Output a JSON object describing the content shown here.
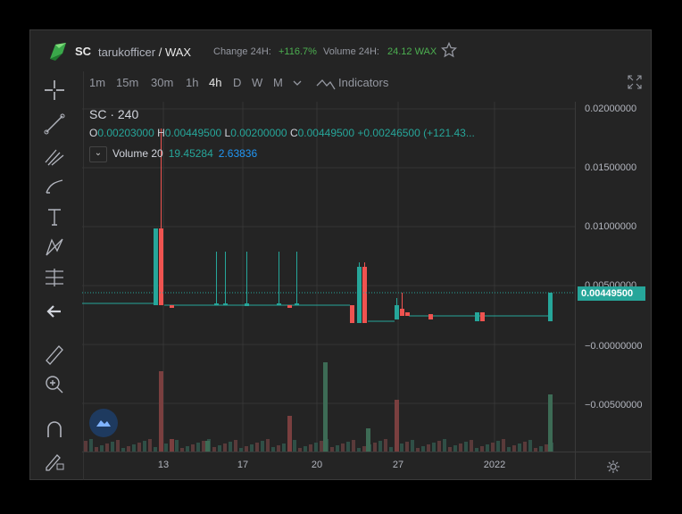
{
  "header": {
    "symbol": "SC",
    "base_account": "tarukofficer",
    "slash": "/",
    "quote": "WAX",
    "change_label": "Change 24H:",
    "change_value": "+116.7%",
    "volume_label": "Volume 24H:",
    "volume_value": "24.12 WAX"
  },
  "timeframes": [
    {
      "label": "1m",
      "active": false
    },
    {
      "label": "15m",
      "active": false
    },
    {
      "label": "30m",
      "active": false
    },
    {
      "label": "1h",
      "active": false
    },
    {
      "label": "4h",
      "active": true
    },
    {
      "label": "D",
      "active": false
    },
    {
      "label": "W",
      "active": false
    },
    {
      "label": "M",
      "active": false
    }
  ],
  "indicators_label": "Indicators",
  "legend": {
    "title": "SC · 240",
    "o_label": "O",
    "o_value": "0.00203000",
    "h_label": "H",
    "h_value": "0.00449500",
    "l_label": "L",
    "l_value": "0.00200000",
    "c_label": "C",
    "c_value": "0.00449500",
    "change": "+0.00246500 (+121.43...",
    "volume_name": "Volume 20",
    "volume_value": "19.45284",
    "volume_ma": "2.63836"
  },
  "price_axis": [
    "0.02000000",
    "0.01500000",
    "0.01000000",
    "0.00500000",
    "−0.00000000",
    "−0.00500000"
  ],
  "current_price": "0.00449500",
  "time_axis": [
    "13",
    "17",
    "20",
    "27",
    "2022"
  ],
  "icons": [
    "crosshair-icon",
    "trend-line-icon",
    "fib-icon",
    "brush-icon",
    "text-icon",
    "pattern-icon",
    "measure-icon",
    "back-arrow-icon",
    "ruler-icon",
    "zoom-icon",
    "magnet-icon",
    "lock-pencil-icon"
  ],
  "colors": {
    "up": "#26a69a",
    "down": "#ef5350",
    "bg": "#242424"
  }
}
